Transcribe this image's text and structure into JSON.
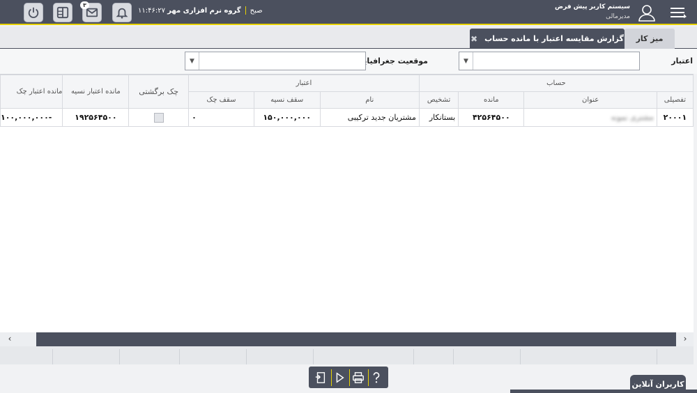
{
  "header": {
    "system_name": "سیستم کاربر پیش فرض",
    "role": "مدیرمالی",
    "company": "گروه نرم افزاری مهر",
    "time": "۱۱:۴۶:۲۷ صبح",
    "message_count": "۳"
  },
  "tabs": [
    {
      "label": "میز کار",
      "active": false
    },
    {
      "label": "گزارش مقایسه اعتبار با مانده حساب",
      "active": true
    }
  ],
  "filters": {
    "credit_label": "اعتبار",
    "location_label": "موقعیت جغرافیایی",
    "credit_value": "",
    "location_value": ""
  },
  "grid": {
    "group_headers": {
      "account": "حساب",
      "credit": "اعتبار"
    },
    "columns": {
      "detail": "تفصیلی",
      "title": "عنوان",
      "balance": "مانده",
      "diagnosis": "تشخیص",
      "name": "نام",
      "credit_limit": "سقف نسیه",
      "check_limit": "سقف چک",
      "returned_check": "چک برگشتی",
      "credit_balance": "مانده اعتبار نسیه",
      "check_credit_balance": "مانده اعتبار چک"
    },
    "rows": [
      {
        "detail": "۲۰۰۰۱",
        "title": "مشتری نمونه",
        "balance": "۴۲۵۶۴۵۰۰",
        "diagnosis": "بستانکار",
        "name": "مشتریان جدید ترکیبی",
        "credit_limit": "۱۵۰,۰۰۰,۰۰۰",
        "check_limit": "۰",
        "returned_check": false,
        "credit_balance": "۱۹۲۵۶۴۵۰۰",
        "check_credit_balance": "-۱۰۰,۰۰۰,۰۰۰"
      }
    ]
  },
  "online_users_label": "کاربران آنلاین",
  "colors": {
    "dark": "#4b505e",
    "accent": "#e8d200",
    "background": "#f1f2f4"
  }
}
